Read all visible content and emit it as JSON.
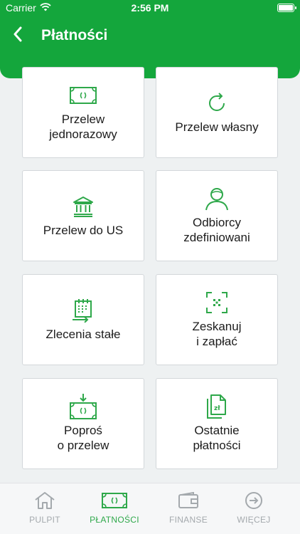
{
  "status_bar": {
    "carrier": "Carrier",
    "time": "2:56 PM"
  },
  "header": {
    "title": "Płatności"
  },
  "tiles": [
    {
      "label": "Przelew\njednorazowy",
      "icon": "banknote-icon"
    },
    {
      "label": "Przelew własny",
      "icon": "refresh-icon"
    },
    {
      "label": "Przelew do US",
      "icon": "bank-icon"
    },
    {
      "label": "Odbiorcy\nzdefiniowani",
      "icon": "person-icon"
    },
    {
      "label": "Zlecenia stałe",
      "icon": "calendar-arrow-icon"
    },
    {
      "label": "Zeskanuj\ni zapłać",
      "icon": "qr-scan-icon"
    },
    {
      "label": "Poproś\no przelew",
      "icon": "banknote-request-icon"
    },
    {
      "label": "Ostatnie\npłatności",
      "icon": "documents-icon"
    }
  ],
  "tabbar": {
    "items": [
      {
        "label": "PULPIT",
        "icon": "home-icon",
        "active": false
      },
      {
        "label": "PŁATNOŚCI",
        "icon": "banknote-icon",
        "active": true
      },
      {
        "label": "FINANSE",
        "icon": "wallet-icon",
        "active": false
      },
      {
        "label": "WIĘCEJ",
        "icon": "arrow-circle-icon",
        "active": false
      }
    ]
  },
  "colors": {
    "brand": "#14a63c",
    "icon_green": "#2ea84a",
    "inactive": "#a4a9ad",
    "background": "#eef1f2"
  }
}
